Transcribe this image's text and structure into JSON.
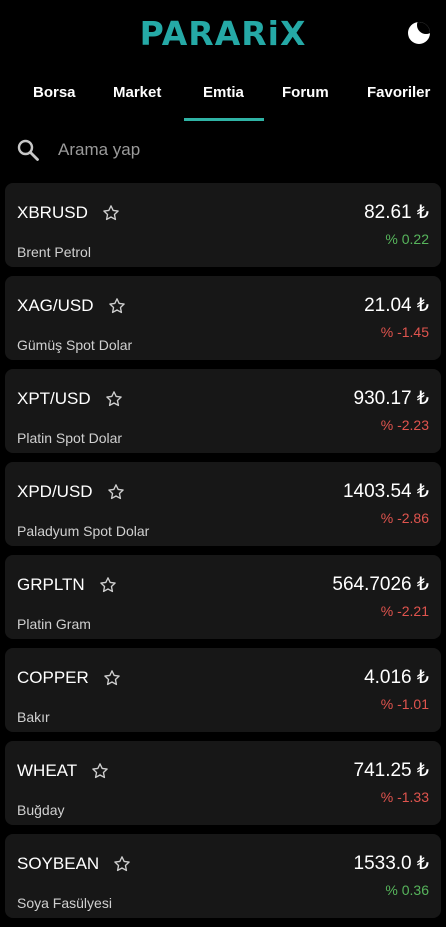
{
  "header": {
    "logo": "PARARiX",
    "theme_icon": "moon-icon"
  },
  "tabs": [
    {
      "label": "Borsa",
      "active": false
    },
    {
      "label": "Market",
      "active": false
    },
    {
      "label": "Emtia",
      "active": true
    },
    {
      "label": "Forum",
      "active": false
    },
    {
      "label": "Favoriler",
      "active": false
    }
  ],
  "search": {
    "placeholder": "Arama yap",
    "value": ""
  },
  "colors": {
    "brand": "#25a9a6",
    "up": "#57b55c",
    "down": "#e0544e",
    "card": "#171717"
  },
  "items": [
    {
      "symbol": "XBRUSD",
      "name": "Brent Petrol",
      "price": "82.61 ₺",
      "change": "% 0.22",
      "direction": "up"
    },
    {
      "symbol": "XAG/USD",
      "name": "Gümüş Spot Dolar",
      "price": "21.04 ₺",
      "change": "% -1.45",
      "direction": "down"
    },
    {
      "symbol": "XPT/USD",
      "name": "Platin Spot Dolar",
      "price": "930.17 ₺",
      "change": "% -2.23",
      "direction": "down"
    },
    {
      "symbol": "XPD/USD",
      "name": "Paladyum Spot Dolar",
      "price": "1403.54 ₺",
      "change": "% -2.86",
      "direction": "down"
    },
    {
      "symbol": "GRPLTN",
      "name": "Platin Gram",
      "price": "564.7026 ₺",
      "change": "% -2.21",
      "direction": "down"
    },
    {
      "symbol": "COPPER",
      "name": "Bakır",
      "price": "4.016 ₺",
      "change": "% -1.01",
      "direction": "down"
    },
    {
      "symbol": "WHEAT",
      "name": "Buğday",
      "price": "741.25 ₺",
      "change": "% -1.33",
      "direction": "down"
    },
    {
      "symbol": "SOYBEAN",
      "name": "Soya Fasülyesi",
      "price": "1533.0 ₺",
      "change": "% 0.36",
      "direction": "up"
    }
  ]
}
